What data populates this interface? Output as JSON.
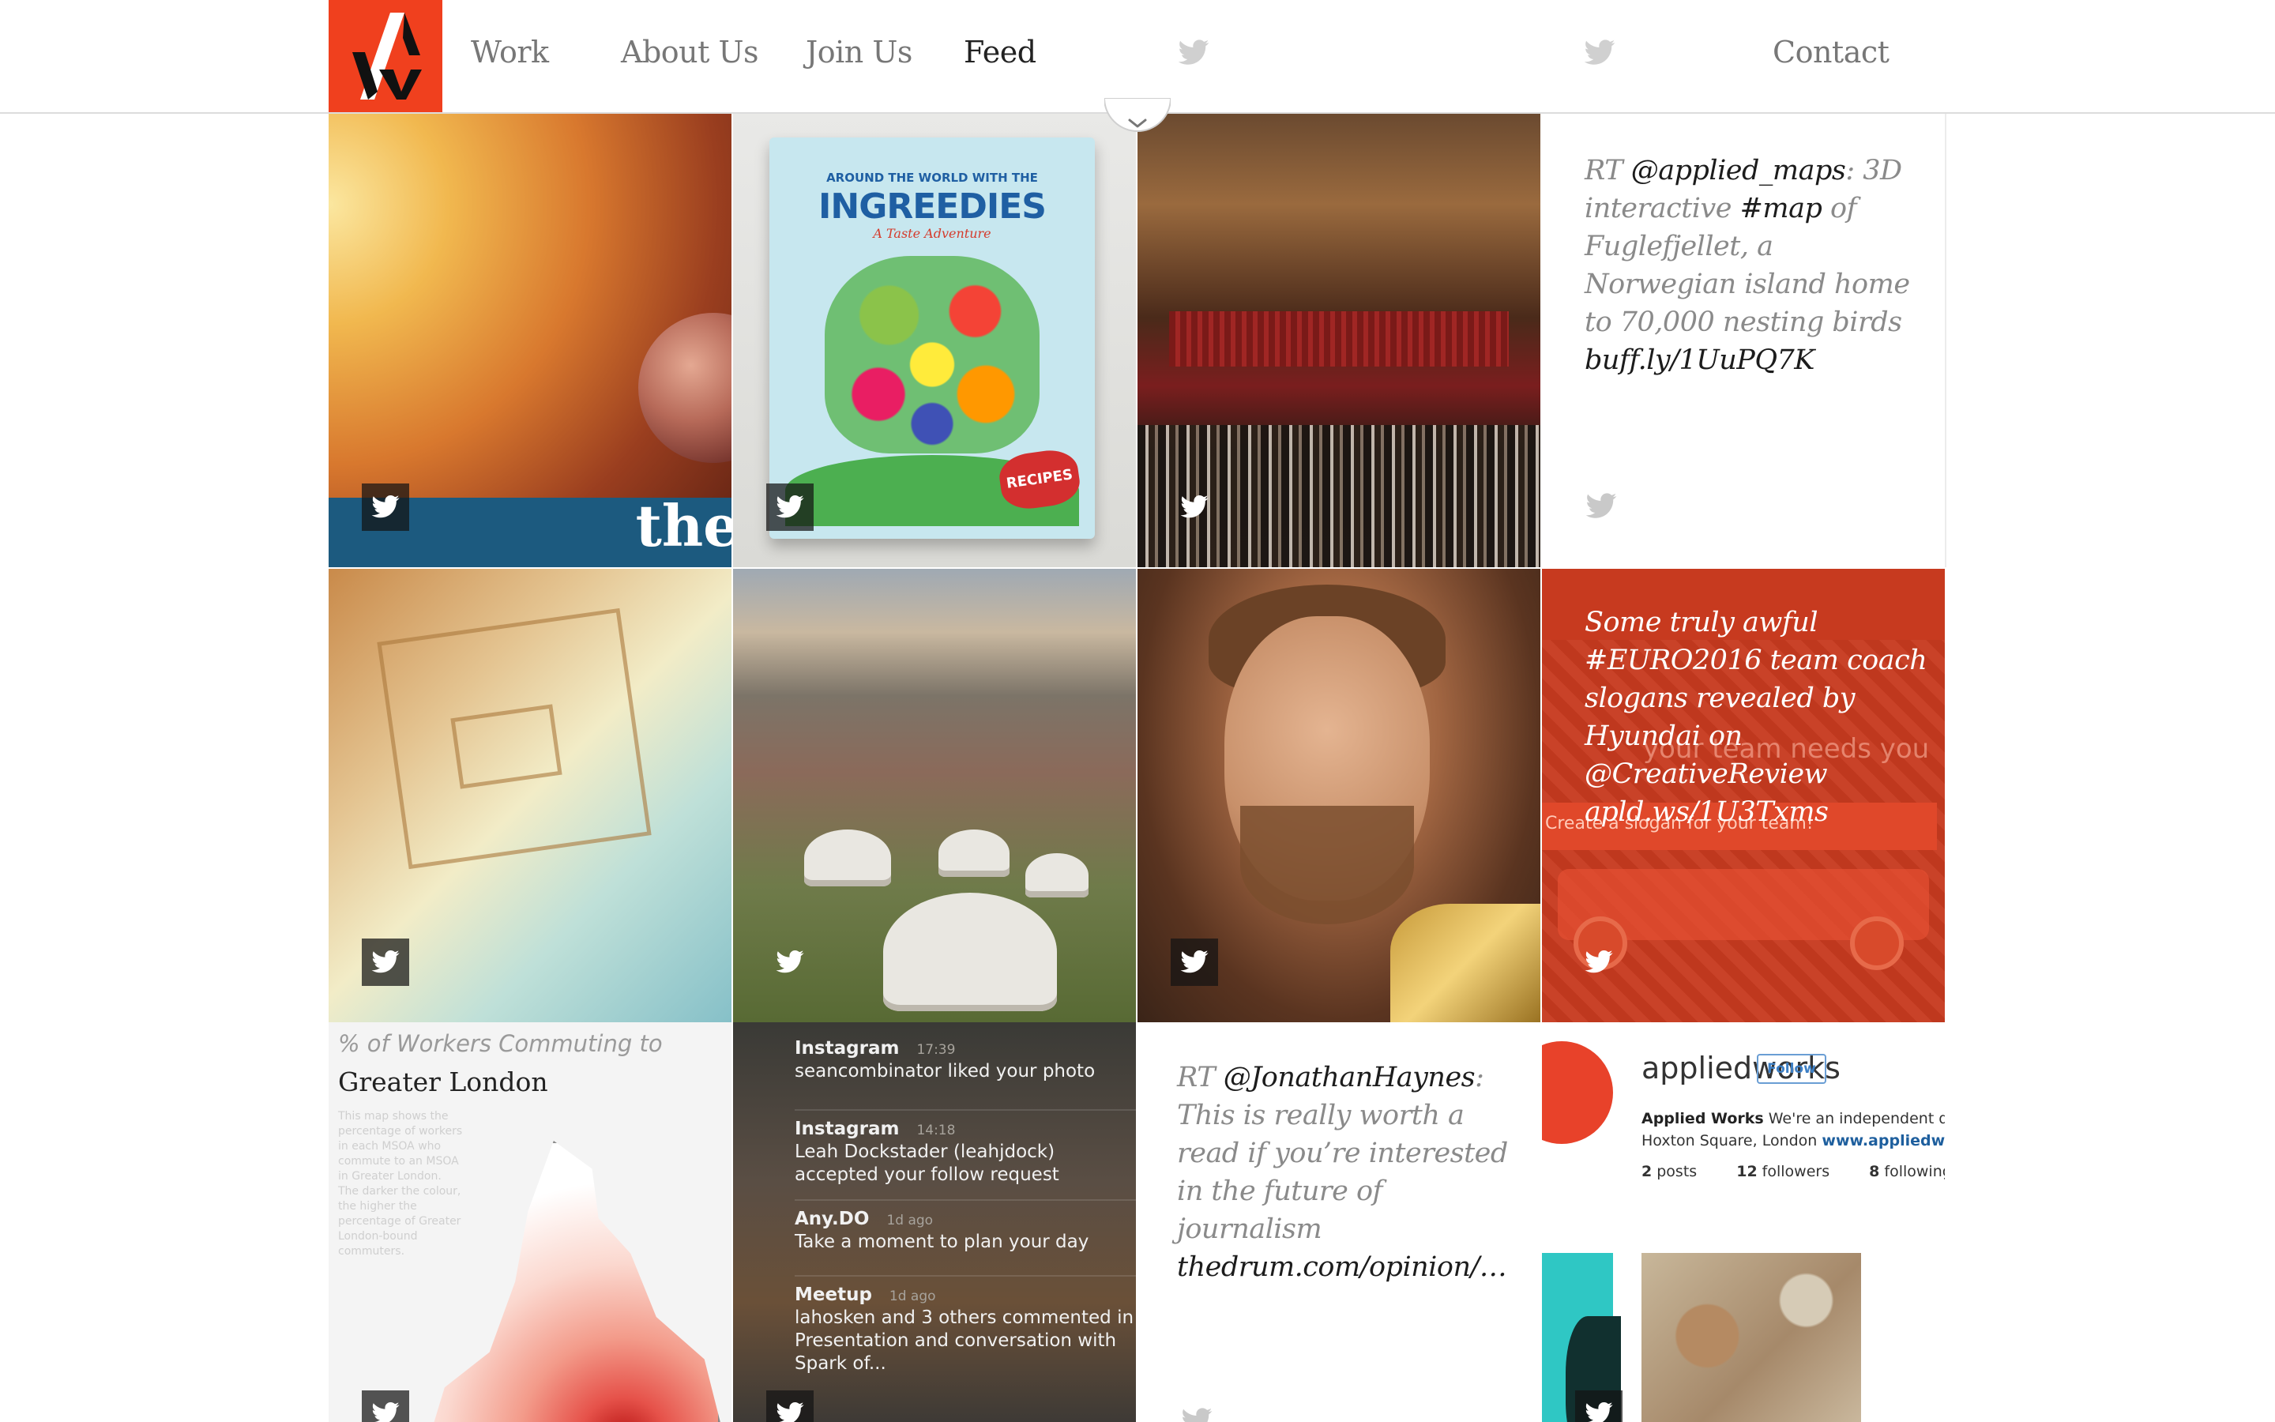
{
  "nav": {
    "items": [
      "Work",
      "About Us",
      "Join Us",
      "Feed"
    ],
    "active": "Feed",
    "contact": "Contact"
  },
  "tiles": {
    "space": {
      "caption": "the"
    },
    "book": {
      "line1": "AROUND THE WORLD WITH THE",
      "title": "INGREEDIES",
      "subtitle": "A Taste Adventure",
      "badge": "RECIPES"
    },
    "tweet_maps": {
      "prefix": "RT ",
      "handle": "@applied_maps",
      "before": ": 3D interactive ",
      "tag": "#map",
      "after": " of Fuglefjellet, a Norwegian island home to 70,000 nesting birds ",
      "link": "buff.ly/1UuPQ7K"
    },
    "euro": {
      "text": "Some truly awful #EURO2016 team coach slogans revealed by Hyundai on @CreativeReview apld.ws/1U3Txms",
      "ghost_text": "your team needs you",
      "bar_text": "Create a slogan for your team!"
    },
    "london": {
      "title1": "% of Workers Commuting to",
      "title2": "Greater London",
      "desc": "This map shows the percentage of workers in each MSOA who commute to an MSOA in Greater London. The darker the colour, the higher the percentage of Greater London-bound commuters."
    },
    "notifications": [
      {
        "app": "Instagram",
        "time": "17:39",
        "body": "seancombinator liked your photo"
      },
      {
        "app": "Instagram",
        "time": "14:18",
        "body": "Leah Dockstader (leahjdock) accepted your follow request"
      },
      {
        "app": "Any.DO",
        "time": "1d ago",
        "body": "Take a moment to plan your day"
      },
      {
        "app": "Meetup",
        "time": "1d ago",
        "body": "lahosken and 3 others commented in Presentation and conversation with Spark of..."
      }
    ],
    "tweet_haynes": {
      "prefix": "RT ",
      "handle": "@JonathanHaynes",
      "before": ": This is really worth a read if you’re interested in the future of journalism ",
      "link": "thedrum.com/opinion/…"
    },
    "insta": {
      "name": "appliedworks",
      "follow": "Follow",
      "bio_bold": "Applied Works",
      "bio_rest": " We're an independent des",
      "bio_line2": "Hoxton Square, London ",
      "bio_link": "www.appliedwor",
      "posts_n": "2",
      "posts_l": "posts",
      "followers_n": "12",
      "followers_l": "followers",
      "following_n": "8",
      "following_l": "following"
    }
  },
  "colors": {
    "brand": "#f0401e",
    "twitter_badge": "#2a2a2a"
  },
  "icons": {
    "twitter": "twitter-bird-icon",
    "scroll": "chevron-down-icon",
    "logo": "applied-works-logo"
  }
}
